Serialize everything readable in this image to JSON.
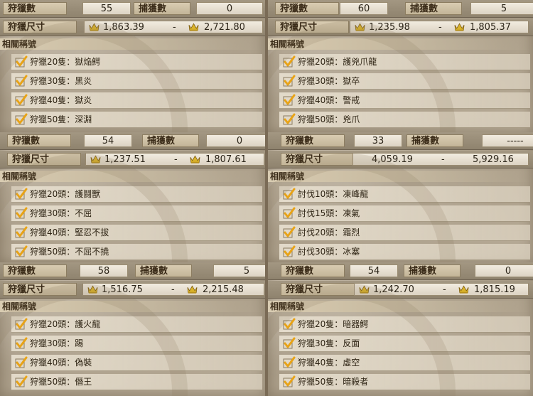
{
  "labels": {
    "hunt_count": "狩獵數",
    "capture_count": "捕獲數",
    "hunt_size": "狩獵尺寸",
    "related_titles": "相關稱號",
    "size_separator": "-"
  },
  "panels": [
    {
      "hunt_count": "55",
      "capture_count": "0",
      "min_size": "1,863.39",
      "max_size": "2,721.80",
      "show_crowns": true,
      "titles": [
        "狩獵20隻：獄焔鰐",
        "狩獵30隻：黑炎",
        "狩獵40隻：獄炎",
        "狩獵50隻：深淵"
      ]
    },
    {
      "hunt_count": "60",
      "capture_count": "5",
      "min_size": "1,235.98",
      "max_size": "1,805.37",
      "show_crowns": true,
      "titles": [
        "狩獵20頭：護兇爪龍",
        "狩獵30頭：獄卒",
        "狩獵40頭：警戒",
        "狩獵50頭：兇爪"
      ]
    },
    {
      "hunt_count": "54",
      "capture_count": "0",
      "min_size": "1,237.51",
      "max_size": "1,807.61",
      "show_crowns": true,
      "titles": [
        "狩獵20頭：護鬪獸",
        "狩獵30頭：不屈",
        "狩獵40頭：堅忍不拔",
        "狩獵50頭：不屈不撓"
      ]
    },
    {
      "hunt_count": "33",
      "capture_count": "-----",
      "min_size": "4,059.19",
      "max_size": "5,929.16",
      "show_crowns": false,
      "titles": [
        "討伐10頭：凍峰龍",
        "討伐15頭：凍氣",
        "討伐20頭：霜烈",
        "討伐30頭：冰塞"
      ]
    },
    {
      "hunt_count": "58",
      "capture_count": "5",
      "min_size": "1,516.75",
      "max_size": "2,215.48",
      "show_crowns": true,
      "titles": [
        "狩獵20頭：護火龍",
        "狩獵30頭：踢",
        "狩獵40頭：偽裝",
        "狩獵50頭：僭王"
      ]
    },
    {
      "hunt_count": "54",
      "capture_count": "0",
      "min_size": "1,242.70",
      "max_size": "1,815.19",
      "show_crowns": true,
      "titles": [
        "狩獵20隻：暗器鰐",
        "狩獵30隻：反面",
        "狩獵40隻：虛空",
        "狩獵50隻：暗殺者"
      ]
    }
  ],
  "icons": {
    "check": "checkmark-icon",
    "crown": "crown-icon"
  },
  "colors": {
    "check": "#e8a317",
    "crown": "#d9b22a"
  }
}
